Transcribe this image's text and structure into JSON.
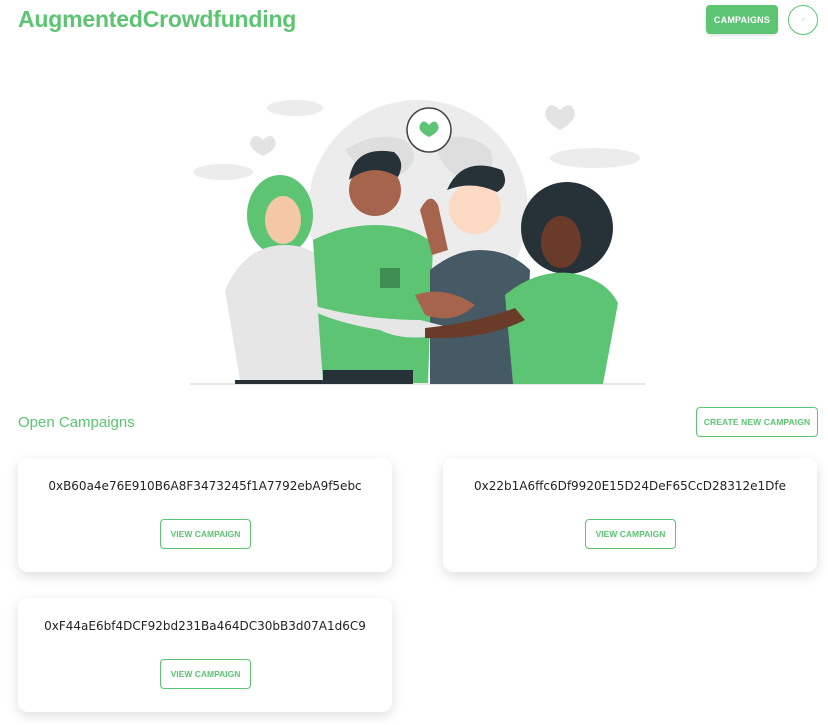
{
  "header": {
    "brand": "AugmentedCrowdfunding",
    "campaigns_label": "CAMPAIGNS",
    "circle_label": "○"
  },
  "section": {
    "title": "Open Campaigns",
    "create_label": "CREATE NEW CAMPAIGN"
  },
  "campaigns": [
    {
      "address": "0xB60a4e76E910B6A8F3473245f1A7792ebA9f5ebc",
      "view_label": "VIEW CAMPAIGN"
    },
    {
      "address": "0x22b1A6ffc6Df9920E15D24DeF65CcD28312e1Dfe",
      "view_label": "VIEW CAMPAIGN"
    },
    {
      "address": "0xF44aE6bf4DCF92bd231Ba464DC30bB3d07A1d6C9",
      "view_label": "VIEW CAMPAIGN"
    }
  ],
  "colors": {
    "accent": "#5cc472",
    "text": "#222222"
  },
  "icons": {
    "hero": "team-illustration",
    "bubble": "heart-icon"
  }
}
